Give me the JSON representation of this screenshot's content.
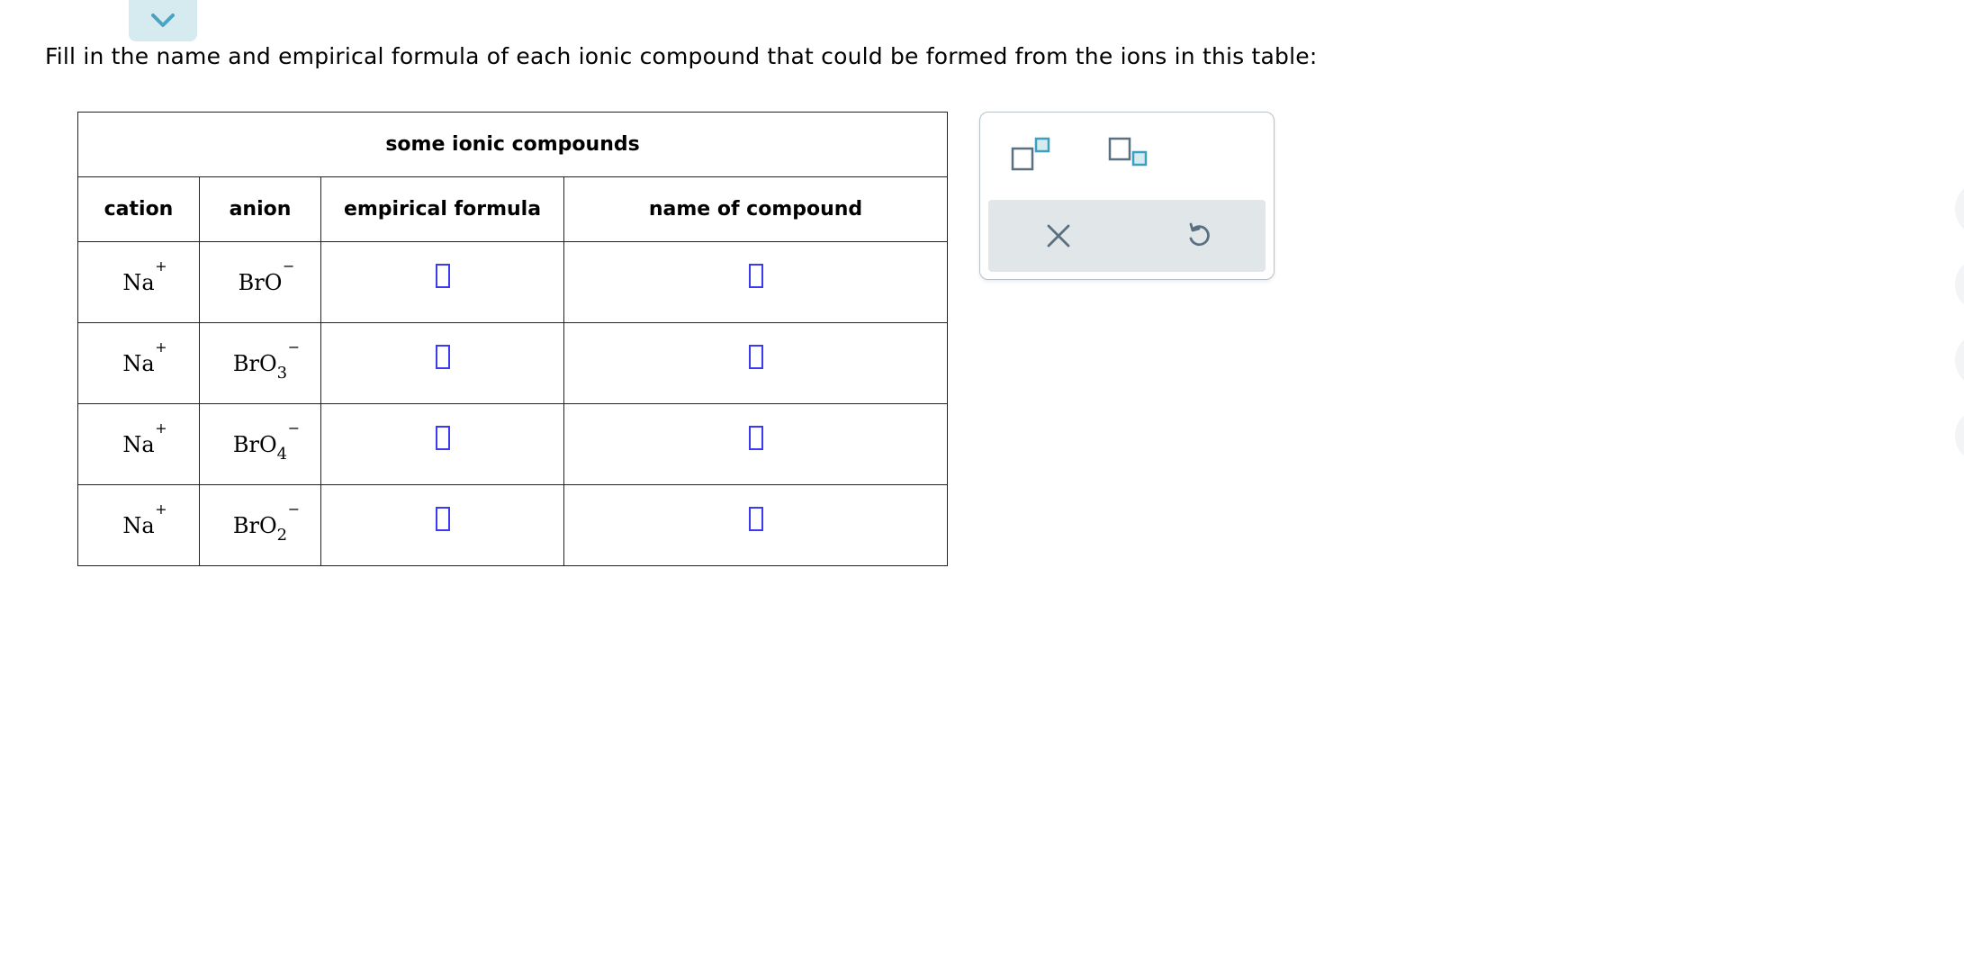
{
  "prompt": "Fill in the name and empirical formula of each ionic compound that could be formed from the ions in this table:",
  "table": {
    "caption": "some ionic compounds",
    "headers": {
      "cation": "cation",
      "anion": "anion",
      "formula": "empirical formula",
      "name": "name of compound"
    },
    "rows": [
      {
        "cation": "Na",
        "cation_charge": "+",
        "anion": "BrO",
        "anion_sub": "",
        "anion_charge": "−",
        "formula": "",
        "name": ""
      },
      {
        "cation": "Na",
        "cation_charge": "+",
        "anion": "BrO",
        "anion_sub": "3",
        "anion_charge": "−",
        "formula": "",
        "name": ""
      },
      {
        "cation": "Na",
        "cation_charge": "+",
        "anion": "BrO",
        "anion_sub": "4",
        "anion_charge": "−",
        "formula": "",
        "name": ""
      },
      {
        "cation": "Na",
        "cation_charge": "+",
        "anion": "BrO",
        "anion_sub": "2",
        "anion_charge": "−",
        "formula": "",
        "name": ""
      }
    ]
  },
  "toolbar": {
    "superscript_icon": "superscript-icon",
    "subscript_icon": "subscript-icon",
    "clear_icon": "close-icon",
    "undo_icon": "undo-icon"
  },
  "colors": {
    "answer_box": "#3a3af0",
    "tab": "#d6ebf0",
    "chevron": "#4aa3c2",
    "tool_icon": "#5a7080",
    "tool_accent": "#3a9fc0",
    "action_bar": "#e1e6e9"
  }
}
